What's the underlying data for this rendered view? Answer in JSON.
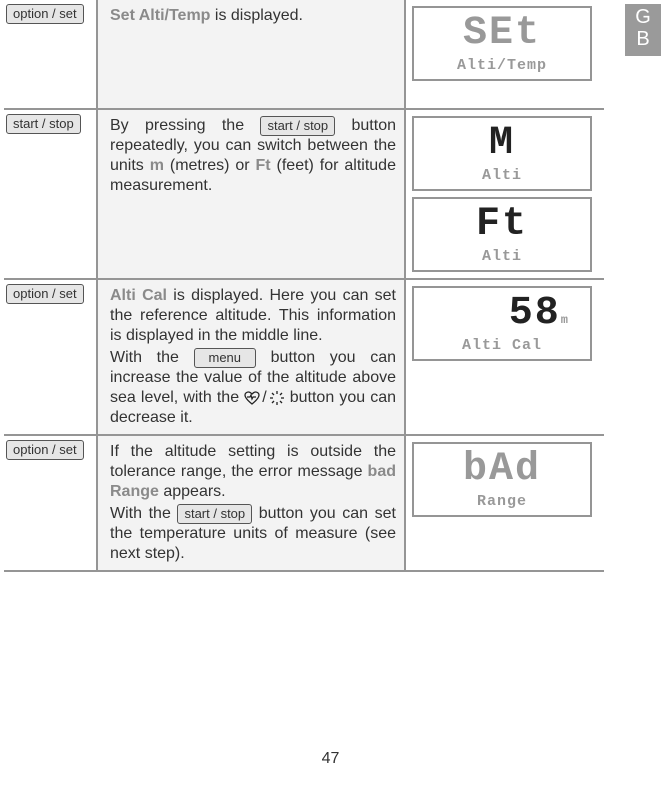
{
  "lang_tab": "GB",
  "page_number": "47",
  "rows": [
    {
      "button": "option / set",
      "desc": {
        "bold1": "Set Alti/Temp",
        "after": " is displayed."
      },
      "displays": [
        {
          "big": "SEt",
          "small": "Alti/Temp",
          "big_color": "gray"
        }
      ]
    },
    {
      "button": "start / stop",
      "desc": {
        "p1a": "By pressing the ",
        "btn": "start / stop",
        "p1b": " button repeatedly, you can switch between the units ",
        "m": "m",
        "p1c": " (metres) or ",
        "ft": "Ft",
        "p1d": " (feet) for altitude measurement."
      },
      "displays": [
        {
          "big": "M",
          "small": "Alti",
          "big_color": "black"
        },
        {
          "big": "Ft",
          "small": "Alti",
          "big_color": "black"
        }
      ]
    },
    {
      "button": "option / set",
      "desc": {
        "bold1": "Alti Cal",
        "p1": " is displayed. Here you can set the reference altitude. This in­formation is displayed in the middle line.",
        "p2a": "With the ",
        "btn": "menu",
        "p2b": " button you can increase the value of the altitude above sea level, with the ",
        "p2c": " button you can decrease it."
      },
      "displays": [
        {
          "big": "58",
          "unit": "m",
          "small": "Alti Cal",
          "big_color": "black"
        }
      ]
    },
    {
      "button": "option / set",
      "desc": {
        "p1a": "If the altitude setting is outside the tolerance range, the error message ",
        "bold1": "bad Range",
        "p1b": " appears.",
        "p2a": "With the ",
        "btn": "start / stop",
        "p2b": " button you can set the temperature units of measure (see next step)."
      },
      "displays": [
        {
          "big": "bAd",
          "small": "Range",
          "big_color": "gray"
        }
      ]
    }
  ],
  "chart_data": {
    "type": "table",
    "columns": [
      "button",
      "instruction",
      "display_main",
      "display_sub"
    ],
    "rows": [
      [
        "option / set",
        "Set Alti/Temp is displayed.",
        "SEt",
        "Alti/Temp"
      ],
      [
        "start / stop",
        "By pressing the start / stop button repeatedly, you can switch between the units m (metres) or Ft (feet) for altitude measurement.",
        "M / Ft",
        "Alti"
      ],
      [
        "option / set",
        "Alti Cal is displayed. Here you can set the reference altitude. This information is displayed in the middle line. With the menu button you can increase the value of the altitude above sea level, with the heart-rate / light button you can decrease it.",
        "58 m",
        "Alti Cal"
      ],
      [
        "option / set",
        "If the altitude setting is outside the tolerance range, the error message bad Range appears. With the start / stop button you can set the temperature units of measure (see next step).",
        "bAd",
        "Range"
      ]
    ]
  }
}
